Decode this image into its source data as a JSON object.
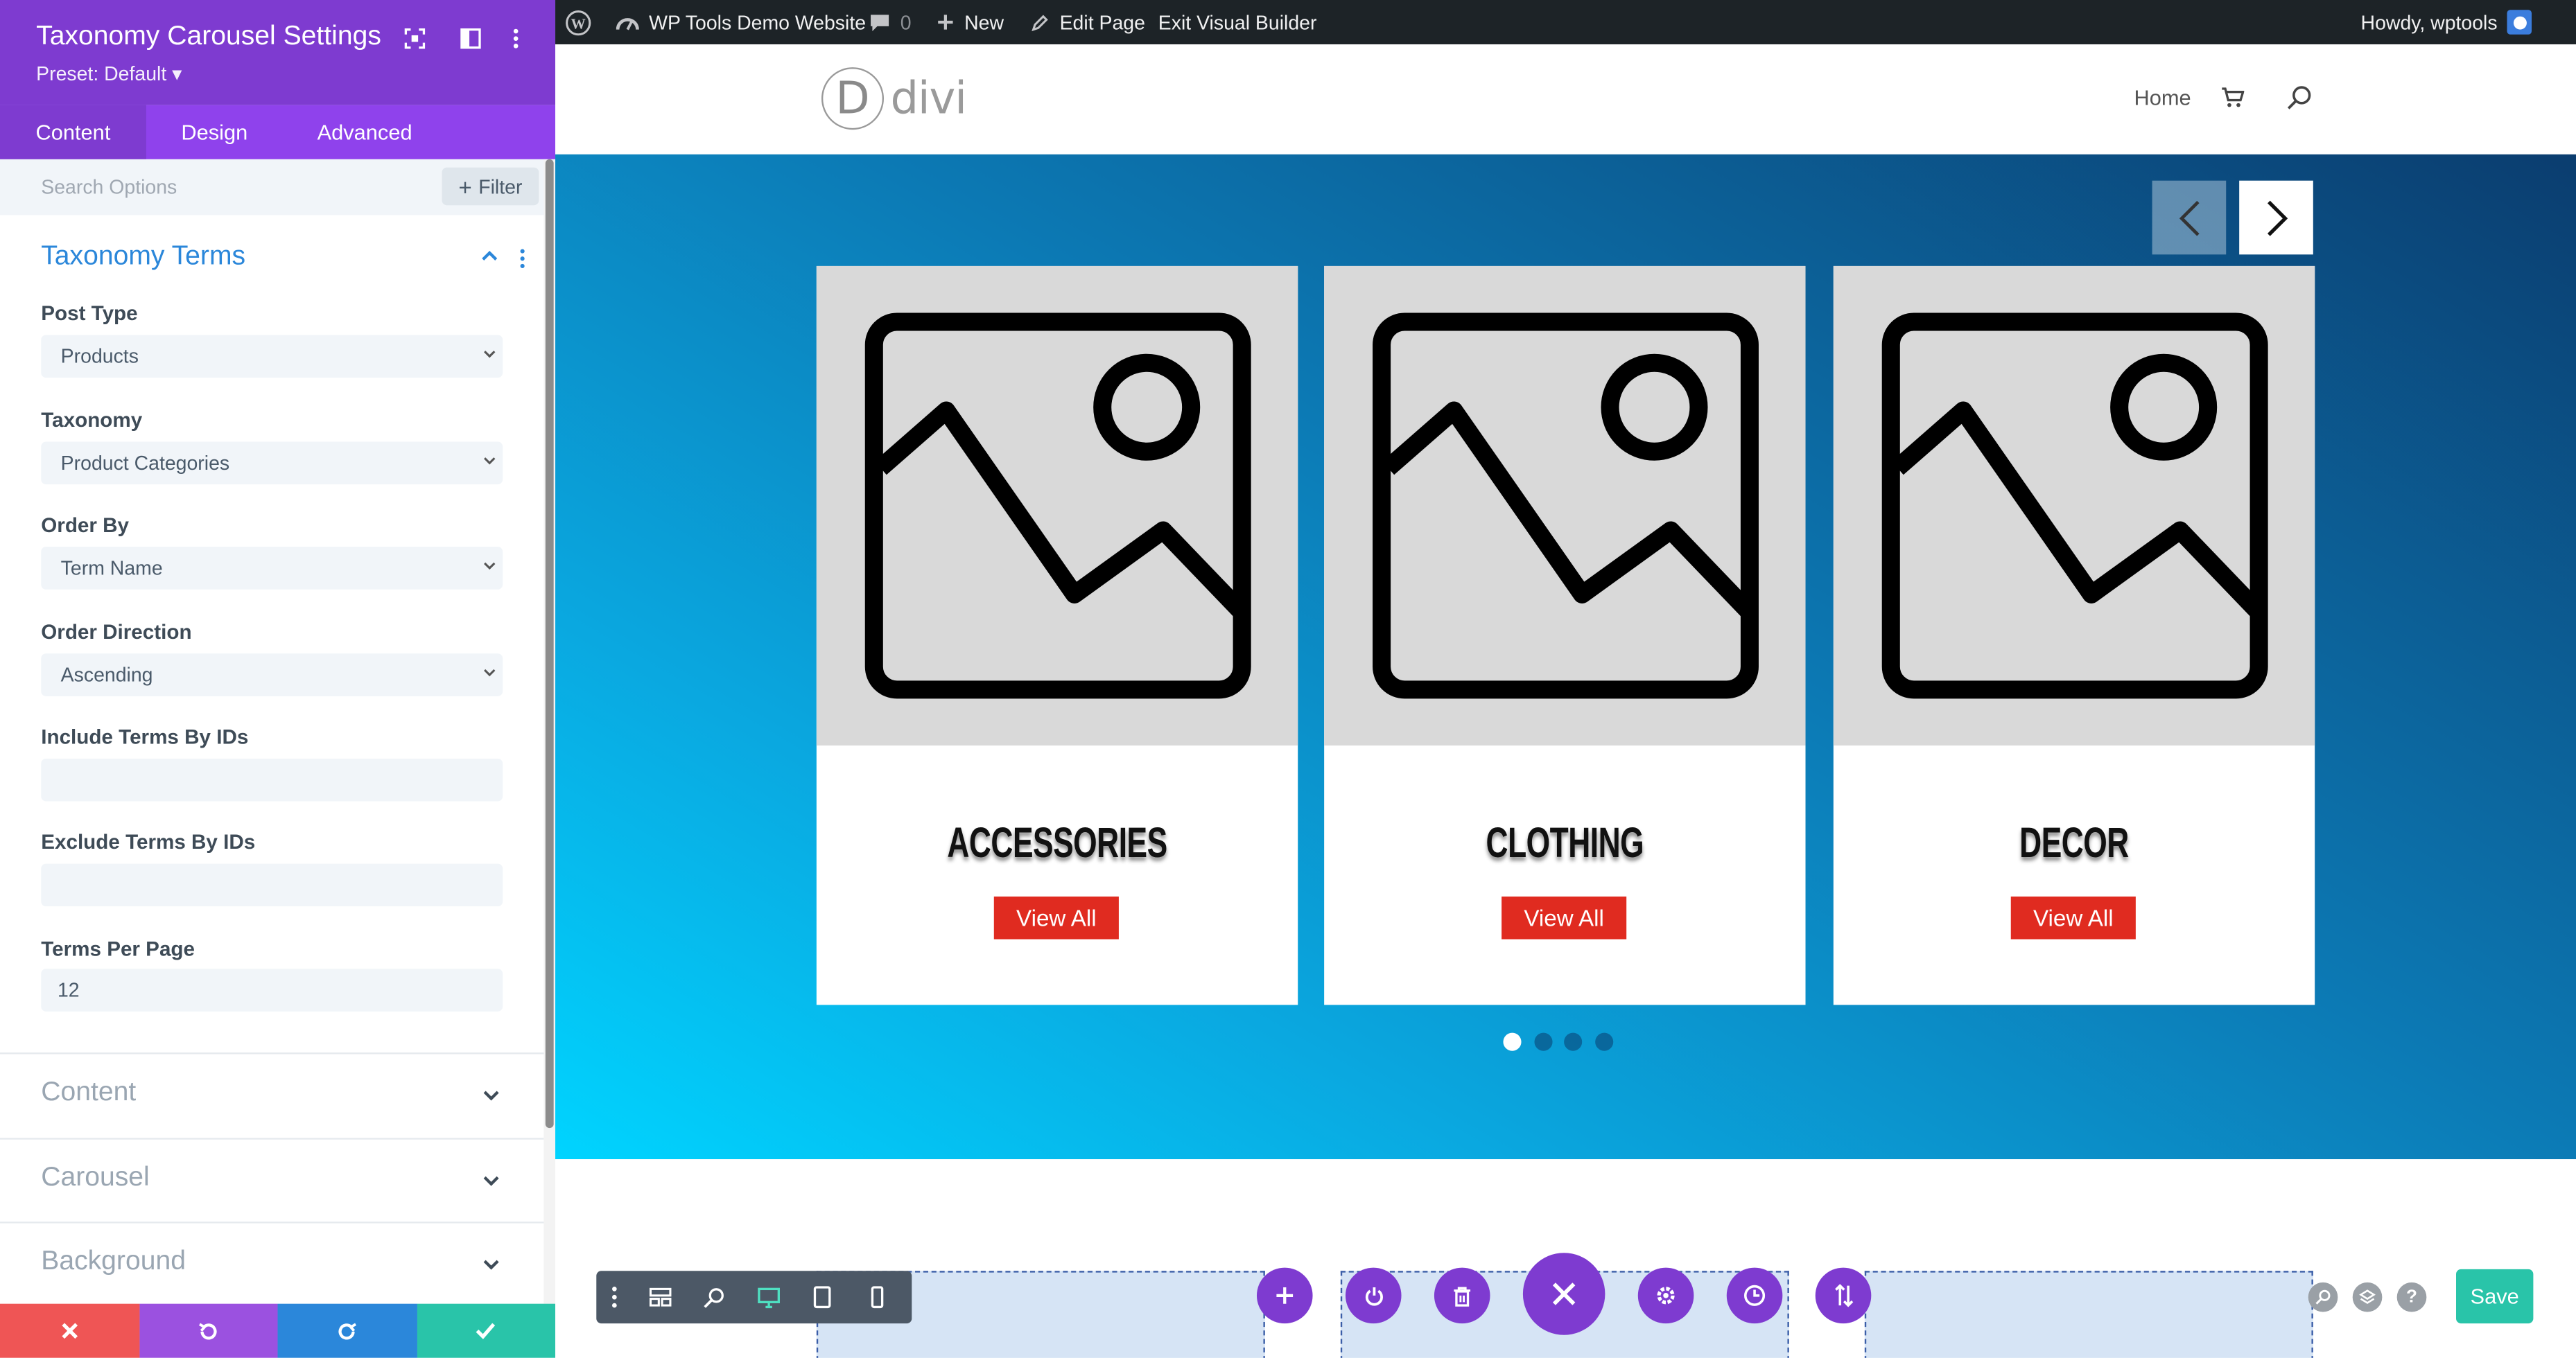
{
  "panel": {
    "title": "Taxonomy Carousel Settings",
    "preset": "Preset: Default ▾",
    "tabs": [
      "Content",
      "Design",
      "Advanced"
    ],
    "search_placeholder": "Search Options",
    "filter_label": "Filter",
    "group_title": "Taxonomy Terms",
    "fields": {
      "post_type": {
        "label": "Post Type",
        "value": "Products"
      },
      "taxonomy": {
        "label": "Taxonomy",
        "value": "Product Categories"
      },
      "order_by": {
        "label": "Order By",
        "value": "Term Name"
      },
      "order_direction": {
        "label": "Order Direction",
        "value": "Ascending"
      },
      "include_ids": {
        "label": "Include Terms By IDs",
        "value": ""
      },
      "exclude_ids": {
        "label": "Exclude Terms By IDs",
        "value": ""
      },
      "per_page": {
        "label": "Terms Per Page",
        "value": "12"
      }
    },
    "sections": [
      "Content",
      "Carousel",
      "Background"
    ]
  },
  "adminbar": {
    "site_name": "WP Tools Demo Website",
    "comments": "0",
    "new_label": "New",
    "edit_label": "Edit Page",
    "exit_label": "Exit Visual Builder",
    "howdy": "Howdy, wptools"
  },
  "site": {
    "logo_letter": "D",
    "logo_text": "divi",
    "nav_home": "Home"
  },
  "carousel": {
    "cards": [
      {
        "title": "ACCESSORIES",
        "button": "View All"
      },
      {
        "title": "CLOTHING",
        "button": "View All"
      },
      {
        "title": "DECOR",
        "button": "View All"
      }
    ],
    "dots": 4,
    "active_dot": 0
  },
  "builder": {
    "save_label": "Save"
  },
  "colors": {
    "purple": "#7e3bd0",
    "purple_light": "#8f42ec",
    "accent_blue": "#2b87da",
    "button_red": "#e02b20",
    "save_green": "#29c4a9",
    "cancel_red": "#ef5555",
    "undo_purple": "#9b51e0",
    "redo_blue": "#2b87da"
  }
}
